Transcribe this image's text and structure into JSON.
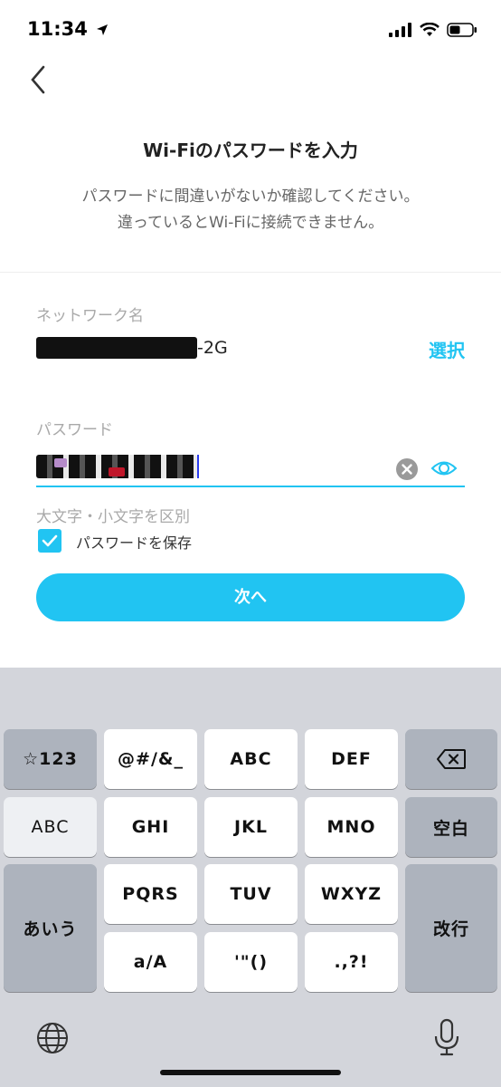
{
  "status_bar": {
    "time": "11:34"
  },
  "header": {
    "title": "Wi-Fiのパスワードを入力",
    "subtitle": "パスワードに間違いがないか確認してください。\n違っているとWi-Fiに接続できません。"
  },
  "form": {
    "network_label": "ネットワーク名",
    "network_value_suffix": "-2G",
    "select_link": "選択",
    "password_label": "パスワード",
    "case_note": "大文字・小文字を区別",
    "save_password_label": "パスワードを保存",
    "save_password_checked": true,
    "next_button": "次へ"
  },
  "keyboard": {
    "row1": [
      "☆123",
      "@#/&_",
      "ABC",
      "DEF"
    ],
    "row2": [
      "ABC",
      "GHI",
      "JKL",
      "MNO",
      "空白"
    ],
    "row3": [
      "あいう",
      "PQRS",
      "TUV",
      "WXYZ",
      "改行"
    ],
    "row4": [
      "a/A",
      "'\"()",
      ".,?!"
    ]
  },
  "colors": {
    "accent": "#21c4f2",
    "keyboard_bg": "#d3d5db",
    "dark_key": "#adb3bd"
  }
}
